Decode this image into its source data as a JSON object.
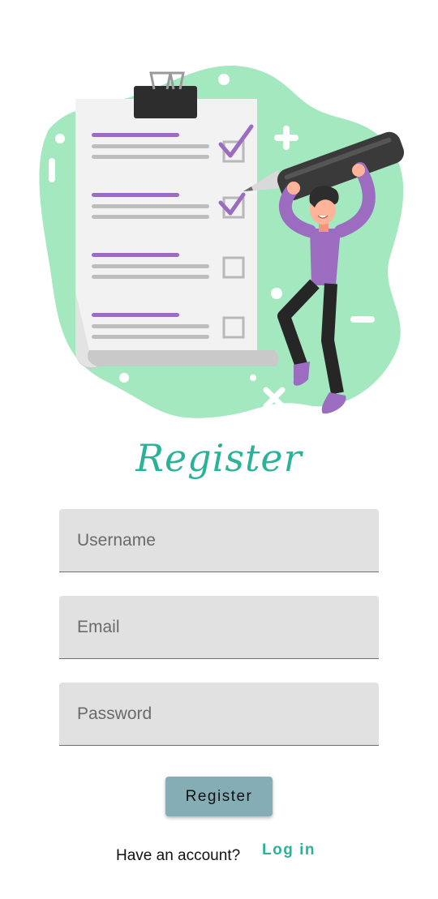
{
  "title": "Register",
  "form": {
    "username_placeholder": "Username",
    "email_placeholder": "Email",
    "password_placeholder": "Password",
    "submit_label": "Register"
  },
  "footer": {
    "prompt": "Have an account?",
    "login_label": "Log in"
  },
  "colors": {
    "accent": "#2bb39a",
    "button": "#84adb6",
    "blob": "#a4e8c0",
    "checklist_purple": "#9b6cc0",
    "field_bg": "#e1e1e1"
  },
  "illustration": {
    "description_icons": [
      "clipboard-icon",
      "checkbox-icon",
      "pencil-icon",
      "person-icon"
    ]
  }
}
